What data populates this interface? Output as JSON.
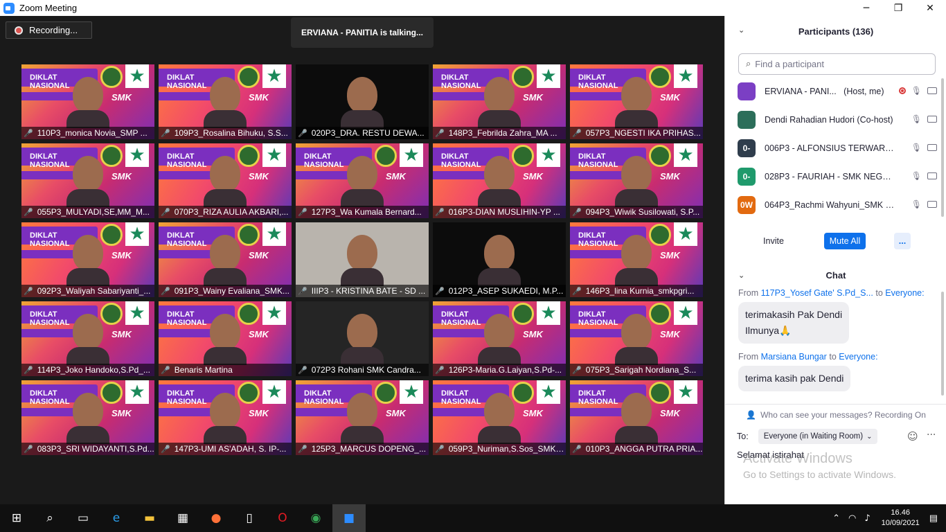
{
  "window": {
    "title": "Zoom Meeting",
    "minimize": "─",
    "maximize": "❐",
    "close": "✕"
  },
  "recording": {
    "label": "Recording..."
  },
  "talking": "ERVIANA - PANITIA is talking...",
  "tiles": [
    {
      "name": "110P3_monica Novia_SMP ...",
      "bg": "bg-a"
    },
    {
      "name": "109P3_Rosalina Bihuku, S.S...",
      "bg": "bg-b"
    },
    {
      "name": "020P3_DRA. RESTU DEWA...",
      "bg": "bg-dark"
    },
    {
      "name": "148P3_Febrilda Zahra_MA ...",
      "bg": "bg-a"
    },
    {
      "name": "057P3_NGESTI IKA PRIHAS...",
      "bg": "bg-b"
    },
    {
      "name": "055P3_MULYADI,SE,MM_M...",
      "bg": "bg-a"
    },
    {
      "name": "070P3_RIZA AULIA AKBARI,...",
      "bg": "bg-b"
    },
    {
      "name": "127P3_Wa Kumala Bernard...",
      "bg": "bg-a"
    },
    {
      "name": "016P3-DIAN MUSLIHIN-YP ...",
      "bg": "bg-b"
    },
    {
      "name": "094P3_Wiwik Susilowati, S.P...",
      "bg": "bg-a"
    },
    {
      "name": "092P3_Waliyah Sabariyanti_...",
      "bg": "bg-b"
    },
    {
      "name": "091P3_Wainy Evaliana_SMK...",
      "bg": "bg-a"
    },
    {
      "name": "IIIP3 - KRISTINA BATE - SD ...",
      "bg": "bg-gray"
    },
    {
      "name": "012P3_ASEP SUKAEDI, M.P...",
      "bg": "bg-dark"
    },
    {
      "name": "146P3_lina Kurnia_smkpgri...",
      "bg": "bg-b"
    },
    {
      "name": "114P3_Joko Handoko,S.Pd_...",
      "bg": "bg-a"
    },
    {
      "name": "Benaris Martina",
      "bg": "bg-b"
    },
    {
      "name": "072P3 Rohani SMK Candra...",
      "bg": "bg-black"
    },
    {
      "name": "126P3-Maria.G.Laiyan,S.Pd-...",
      "bg": "bg-a"
    },
    {
      "name": "075P3_Sarigah Nordiana_S...",
      "bg": "bg-b"
    },
    {
      "name": "083P3_SRI WIDAYANTI,S.Pd...",
      "bg": "bg-a"
    },
    {
      "name": "147P3-UMI AS'ADAH, S. IP-...",
      "bg": "bg-b"
    },
    {
      "name": "125P3_MARCUS  DOPENG_...",
      "bg": "bg-a"
    },
    {
      "name": "059P3_Nuriman,S.Sos_SMK N...",
      "bg": "bg-b"
    },
    {
      "name": "010P3_ANGGA PUTRA PRIA...",
      "bg": "bg-a"
    }
  ],
  "tile_banner": "DIKLAT NASIONAL",
  "tile_logo": "SMK",
  "participants": {
    "title": "Participants (136)",
    "search_placeholder": "Find a participant",
    "list": [
      {
        "avatar": "",
        "avatar_color": "#7b3fc4",
        "name": "ERVIANA - PANI...",
        "role": "(Host, me)"
      },
      {
        "avatar": "",
        "avatar_color": "#2c6e5a",
        "name": "Dendi Rahadian Hudori (Co-host)",
        "role": ""
      },
      {
        "avatar": "0-",
        "avatar_color": "#2f3d4c",
        "name": "006P3 - ALFONSIUS TERWARAT,...",
        "role": ""
      },
      {
        "avatar": "0-",
        "avatar_color": "#1f9a6c",
        "name": "028P3 - FAURIAH - SMK NEGERI...",
        "role": ""
      },
      {
        "avatar": "0W",
        "avatar_color": "#e26a10",
        "name": "064P3_Rachmi Wahyuni_SMK M...",
        "role": ""
      }
    ],
    "invite": "Invite",
    "mute_all": "Mute All",
    "more": "..."
  },
  "chat": {
    "title": "Chat",
    "messages": [
      {
        "from_prefix": "From",
        "sender": "117P3_Yosef Gate' S.Pd_S...",
        "to_word": "to",
        "to": "Everyone:",
        "text_line1": "terimakasih Pak Dendi",
        "text_line2": "Ilmunya🙏"
      },
      {
        "from_prefix": "From",
        "sender": "Marsiana Bungar",
        "to_word": "to",
        "to": "Everyone:",
        "text_line1": "terima kasih pak Dendi",
        "text_line2": ""
      }
    ],
    "who_can_see": "Who can see your messages? Recording On",
    "to_label": "To:",
    "to_value": "Everyone (in Waiting Room)",
    "draft": "Selamat istirahat",
    "watermark_title": "Activate Windows",
    "watermark_sub": "Go to Settings to activate Windows."
  },
  "taskbar": {
    "time": "16.46",
    "date": "10/09/2021"
  }
}
